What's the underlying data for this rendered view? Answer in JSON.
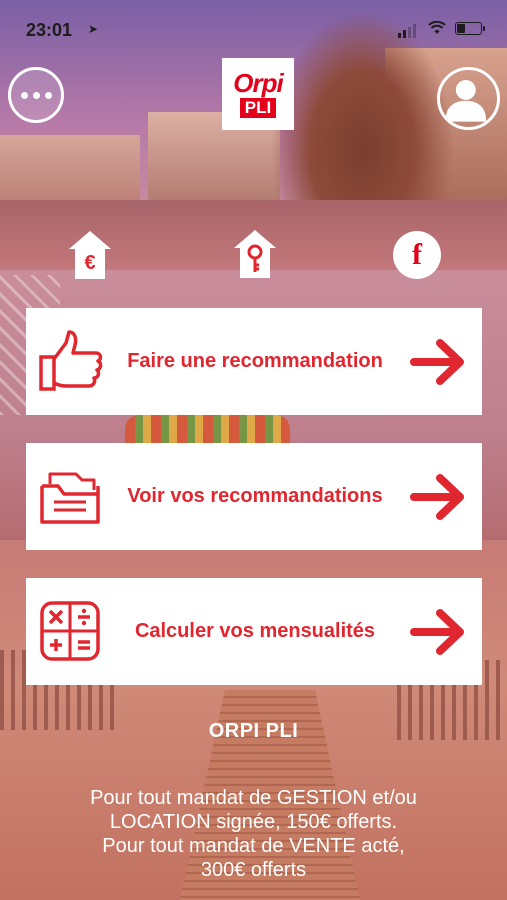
{
  "status_bar": {
    "time": "23:01"
  },
  "header": {
    "logo_line1": "Orpi",
    "logo_line2": "PLI"
  },
  "icons": {
    "menu": "more-icon",
    "profile": "user-icon",
    "euro_house": "euro-house-icon",
    "key_house": "key-house-icon",
    "facebook": "facebook-icon",
    "facebook_glyph": "f"
  },
  "colors": {
    "accent": "#e0262f",
    "brand": "#e2001a"
  },
  "actions": [
    {
      "label": "Faire une recommandation",
      "icon": "thumbs-up-icon"
    },
    {
      "label": "Voir vos recommandations",
      "icon": "folder-icon"
    },
    {
      "label": "Calculer vos mensualités",
      "icon": "calculator-icon"
    }
  ],
  "footer": {
    "title": "ORPI PLI",
    "line1": "Pour tout mandat de GESTION et/ou",
    "line2": "LOCATION signée, 150€ offerts.",
    "line3": "Pour tout mandat de VENTE acté,",
    "line4": "300€ offerts"
  }
}
